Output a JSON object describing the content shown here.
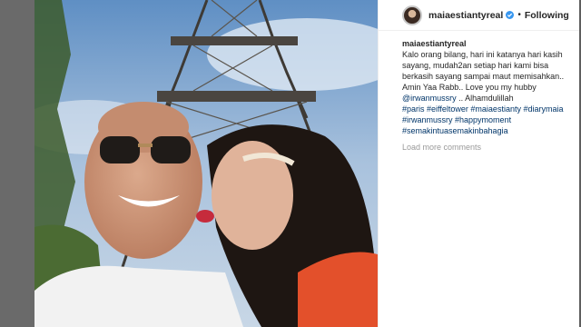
{
  "header": {
    "username": "maiaestiantyreal",
    "verified_icon": "verified-badge-icon",
    "separator": "•",
    "follow_label": "Following"
  },
  "caption": {
    "username": "maiaestiantyreal",
    "lines": [
      "Kalo orang bilang, hari ini katanya hari kasih",
      "sayang, mudah2an setiap hari kami bisa",
      "berkasih sayang sampai maut memisahkan..",
      "Amin Yaa Rabb.. Love you my hubby"
    ],
    "mention": "@irwanmussry",
    "after_mention": " .. Alhamdulillah",
    "hashtag_lines": [
      [
        "#paris",
        "#eiffeltower",
        "#maiaestianty",
        "#diarymaia"
      ],
      [
        "#irwanmussry",
        "#happymoment"
      ],
      [
        "#semakintuasemakinbahagia"
      ]
    ]
  },
  "load_more": "Load more comments",
  "colors": {
    "link": "#003569",
    "accent_verified": "#3897f0"
  }
}
